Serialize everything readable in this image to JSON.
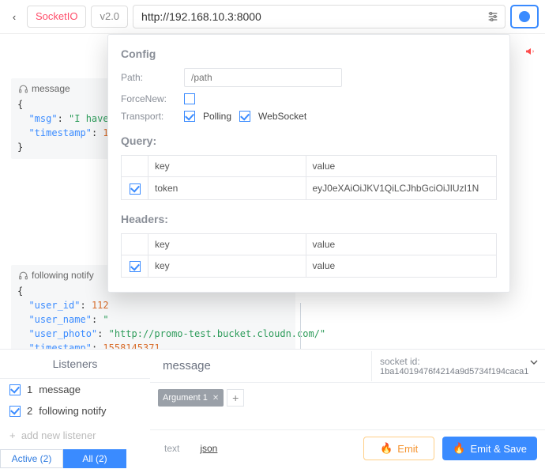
{
  "topbar": {
    "back_glyph": "‹",
    "socket_label": "SocketIO",
    "version_label": "v2.0",
    "url_value": "http://192.168.10.3:8000"
  },
  "secondary": {
    "chev_glyph": "‹"
  },
  "messages": {
    "msg1": {
      "title": "message",
      "line1_key": "\"msg\"",
      "line1_val": "\"I have",
      "line2_key": "\"timestamp\"",
      "line2_val": "1"
    },
    "msg2": {
      "title": "following notify",
      "l1_key": "\"user_id\"",
      "l1_val": "112",
      "l2_key": "\"user_name\"",
      "l2_val": "\"",
      "l3_key": "\"user_photo\"",
      "l3_val": "\"http://promo-test.bucket.cloudn.com/\"",
      "l4_key": "\"timestamp\"",
      "l4_val": "1558145371"
    }
  },
  "config": {
    "heading": "Config",
    "path_label": "Path:",
    "path_placeholder": "/path",
    "forcenew_label": "ForceNew:",
    "transport_label": "Transport:",
    "polling_label": "Polling",
    "websocket_label": "WebSocket",
    "query_heading": "Query:",
    "headers_heading": "Headers:",
    "col_key": "key",
    "col_value": "value",
    "query_row": {
      "key": "token",
      "value": "eyJ0eXAiOiJKV1QiLCJhbGciOiJIUzI1N"
    },
    "headers_row": {
      "key_ph": "key",
      "value_ph": "value"
    }
  },
  "listeners": {
    "heading": "Listeners",
    "item1_prefix": "1",
    "item1_label": "message",
    "item2_prefix": "2",
    "item2_label": "following notify",
    "add_placeholder": "add new listener",
    "add_plus": "+",
    "tab_active": "Active  (2)",
    "tab_all": "All  (2)"
  },
  "emit": {
    "name": "message",
    "socket_label": "socket id:",
    "socket_id": "1ba14019476f4214a9d5734f194caca1",
    "arg_chip": "Argument 1",
    "mode_text": "text",
    "mode_json": "json",
    "emit_label": "Emit",
    "emit_save_label": "Emit & Save"
  }
}
